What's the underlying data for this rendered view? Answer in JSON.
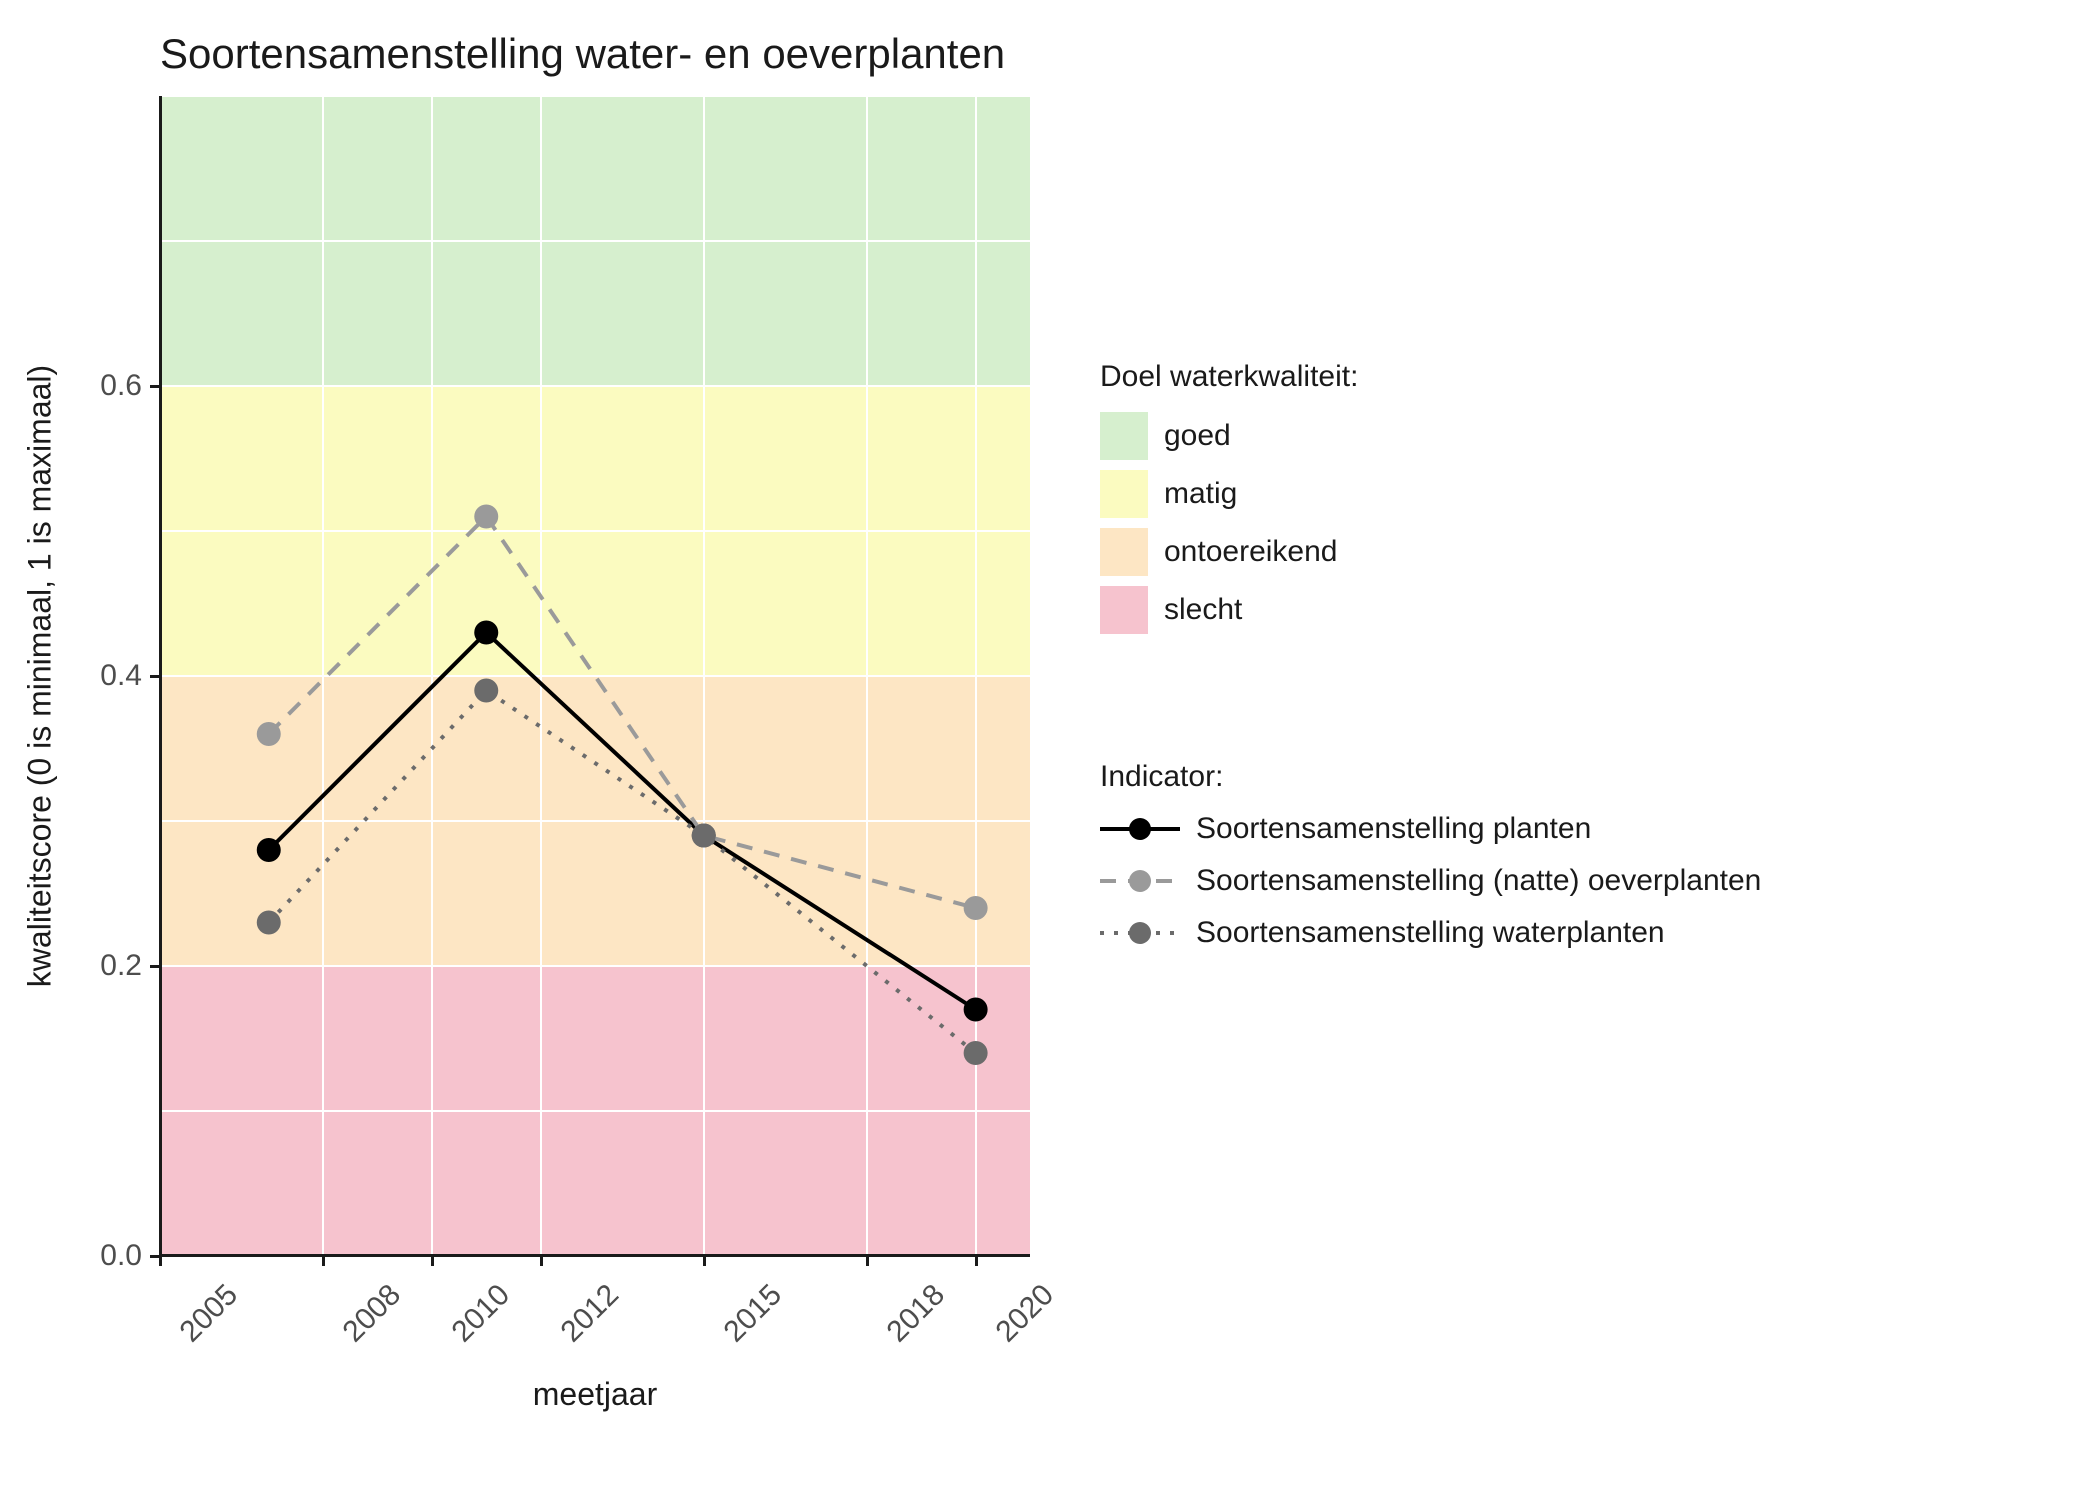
{
  "chart_data": {
    "type": "line",
    "title": "Soortensamenstelling water- en oeverplanten",
    "xlabel": "meetjaar",
    "ylabel": "kwaliteitscore (0 is minimaal, 1 is maximaal)",
    "x_ticks": [
      2005,
      2008,
      2010,
      2012,
      2015,
      2018,
      2020
    ],
    "y_ticks": [
      0.0,
      0.2,
      0.4,
      0.6
    ],
    "xlim": [
      2005,
      2021
    ],
    "ylim": [
      0.0,
      0.8
    ],
    "bands": [
      {
        "name": "slecht",
        "from": 0.0,
        "to": 0.2,
        "color": "#f6c3ce"
      },
      {
        "name": "ontoereikend",
        "from": 0.2,
        "to": 0.4,
        "color": "#fde6c4"
      },
      {
        "name": "matig",
        "from": 0.4,
        "to": 0.6,
        "color": "#fbfbc0"
      },
      {
        "name": "goed",
        "from": 0.6,
        "to": 0.8,
        "color": "#d6efce"
      }
    ],
    "band_legend_title": "Doel waterkwaliteit:",
    "band_legend_order": [
      "goed",
      "matig",
      "ontoereikend",
      "slecht"
    ],
    "indicator_legend_title": "Indicator:",
    "series": [
      {
        "name": "Soortensamenstelling planten",
        "x": [
          2007,
          2011,
          2015,
          2020
        ],
        "y": [
          0.28,
          0.43,
          0.29,
          0.17
        ],
        "color": "#000000",
        "dash": "solid"
      },
      {
        "name": "Soortensamenstelling (natte) oeverplanten",
        "x": [
          2007,
          2011,
          2015,
          2020
        ],
        "y": [
          0.36,
          0.51,
          0.29,
          0.24
        ],
        "color": "#9a9a9a",
        "dash": "dashed"
      },
      {
        "name": "Soortensamenstelling waterplanten",
        "x": [
          2007,
          2011,
          2015,
          2020
        ],
        "y": [
          0.23,
          0.39,
          0.29,
          0.14
        ],
        "color": "#6b6b6b",
        "dash": "dotted"
      }
    ]
  }
}
